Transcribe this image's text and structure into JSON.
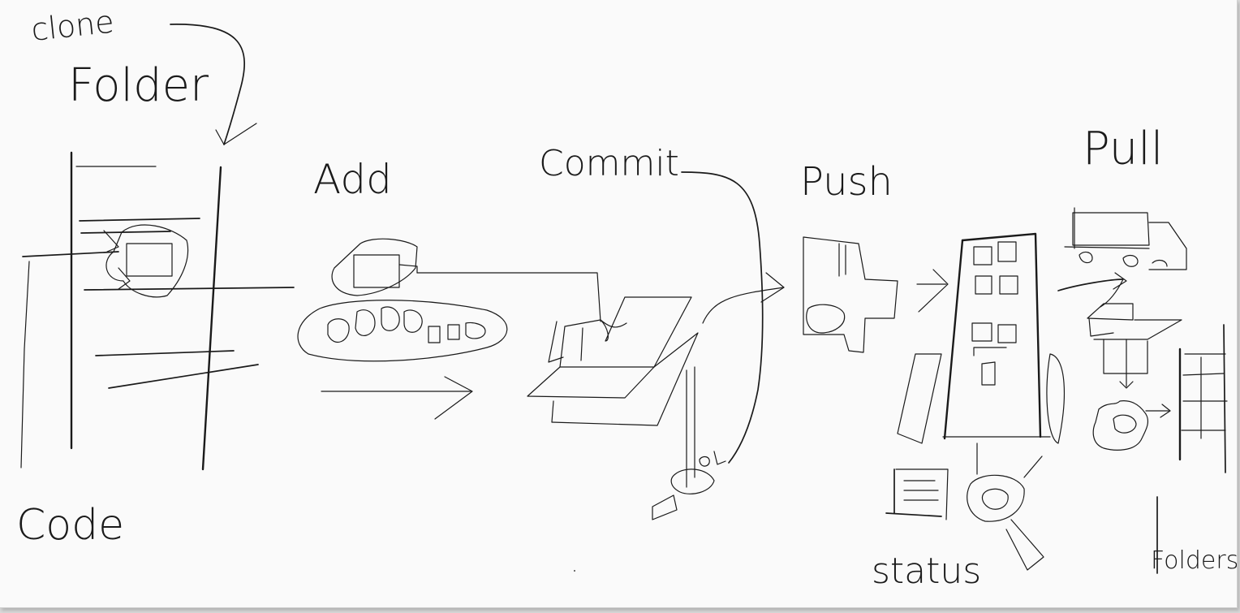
{
  "canvas": {
    "background": "#fafafa",
    "ink": "#1a1a1a"
  },
  "labels": {
    "clone": "clone",
    "folder": "Folder",
    "code": "Code",
    "add": "Add",
    "commit": "Commit",
    "push": "Push",
    "pull": "Pull",
    "status": "status",
    "folders": "Folders"
  },
  "icons": [
    "folder-stack-icon",
    "file-on-tray-icon",
    "open-box-icon",
    "server-tower-icon",
    "truck-icon",
    "magnifier-icon",
    "document-icon",
    "gear-icon"
  ]
}
